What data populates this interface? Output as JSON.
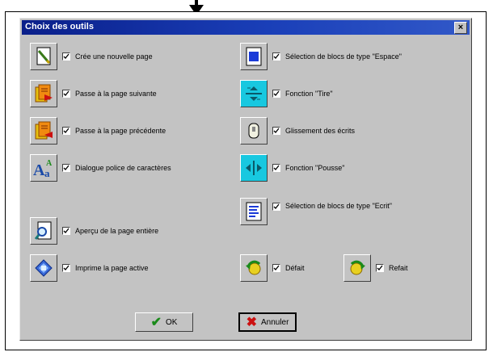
{
  "dialog": {
    "title": "Choix des outils",
    "close_label": "×"
  },
  "tools_left": [
    {
      "label": "Crée une nouvelle page",
      "checked": true,
      "icon": "new-page-icon"
    },
    {
      "label": "Passe à la page suivante",
      "checked": true,
      "icon": "next-page-icon"
    },
    {
      "label": "Passe à la page précédente",
      "checked": true,
      "icon": "previous-page-icon"
    },
    {
      "label": "Dialogue police de caractères",
      "checked": true,
      "icon": "font-dialog-icon"
    },
    {
      "label": "Aperçu de la page entière",
      "checked": true,
      "icon": "page-preview-icon"
    },
    {
      "label": "Imprime la page active",
      "checked": true,
      "icon": "print-icon"
    }
  ],
  "tools_right": [
    {
      "label": "Sélection de blocs de type \"Espace\"",
      "checked": true,
      "icon": "space-block-select-icon"
    },
    {
      "label": "Fonction \"Tire\"",
      "checked": true,
      "icon": "pull-function-icon"
    },
    {
      "label": "Glissement des écrits",
      "checked": true,
      "icon": "text-drag-icon"
    },
    {
      "label": "Fonction \"Pousse\"",
      "checked": true,
      "icon": "push-function-icon"
    },
    {
      "label": "Sélection de blocs de type \"Ecrit\"",
      "checked": true,
      "icon": "text-block-select-icon"
    },
    {
      "label": "Défait",
      "checked": true,
      "icon": "undo-icon"
    },
    {
      "label": "Refait",
      "checked": true,
      "icon": "redo-icon"
    }
  ],
  "buttons": {
    "ok": "OK",
    "cancel": "Annuler"
  },
  "colors": {
    "titlebar": "#0a1f8a",
    "dialog_bg": "#c3c3c3",
    "ok_check": "#1a8a1a",
    "cancel_x": "#cc1111"
  }
}
